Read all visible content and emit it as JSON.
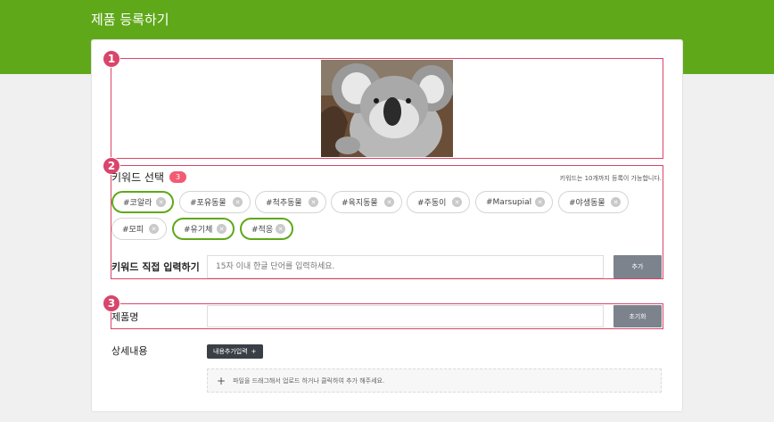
{
  "header": {
    "title": "제품 등록하기"
  },
  "markers": [
    "1",
    "2",
    "3"
  ],
  "product_image": {
    "alt": "코알라"
  },
  "keywords": {
    "section_title": "키워드 선택",
    "selected_count": "3",
    "limit_note": "키워드는 10개까지 등록이 가능합니다.",
    "tags": [
      {
        "label": "#코알라",
        "selected": true
      },
      {
        "label": "#포유동물",
        "selected": false
      },
      {
        "label": "#척추동물",
        "selected": false
      },
      {
        "label": "#육지동물",
        "selected": false
      },
      {
        "label": "#주동이",
        "selected": false
      },
      {
        "label": "#Marsupial",
        "selected": false
      },
      {
        "label": "#야생동물",
        "selected": false
      },
      {
        "label": "#모피",
        "selected": false
      },
      {
        "label": "#유기체",
        "selected": true
      },
      {
        "label": "#적응",
        "selected": true
      }
    ],
    "remove_glyph": "✕",
    "direct_input_label": "키워드 직접 입력하기",
    "direct_input_placeholder": "15자 이내 한글 단어를 입력하세요.",
    "add_button": "추가"
  },
  "product_name": {
    "label": "제품명",
    "value": "",
    "reset_button": "초기화"
  },
  "details": {
    "label": "상세내용",
    "add_content_button": "내용추가입력",
    "add_content_icon": "+",
    "dropzone_icon": "+",
    "dropzone_text": "파일을 드래그해서 업로드 하거나 클릭하여 추가 해주세요."
  },
  "colors": {
    "brand_green": "#5fa81a",
    "highlight": "#d9456b",
    "badge": "#f25b73"
  }
}
